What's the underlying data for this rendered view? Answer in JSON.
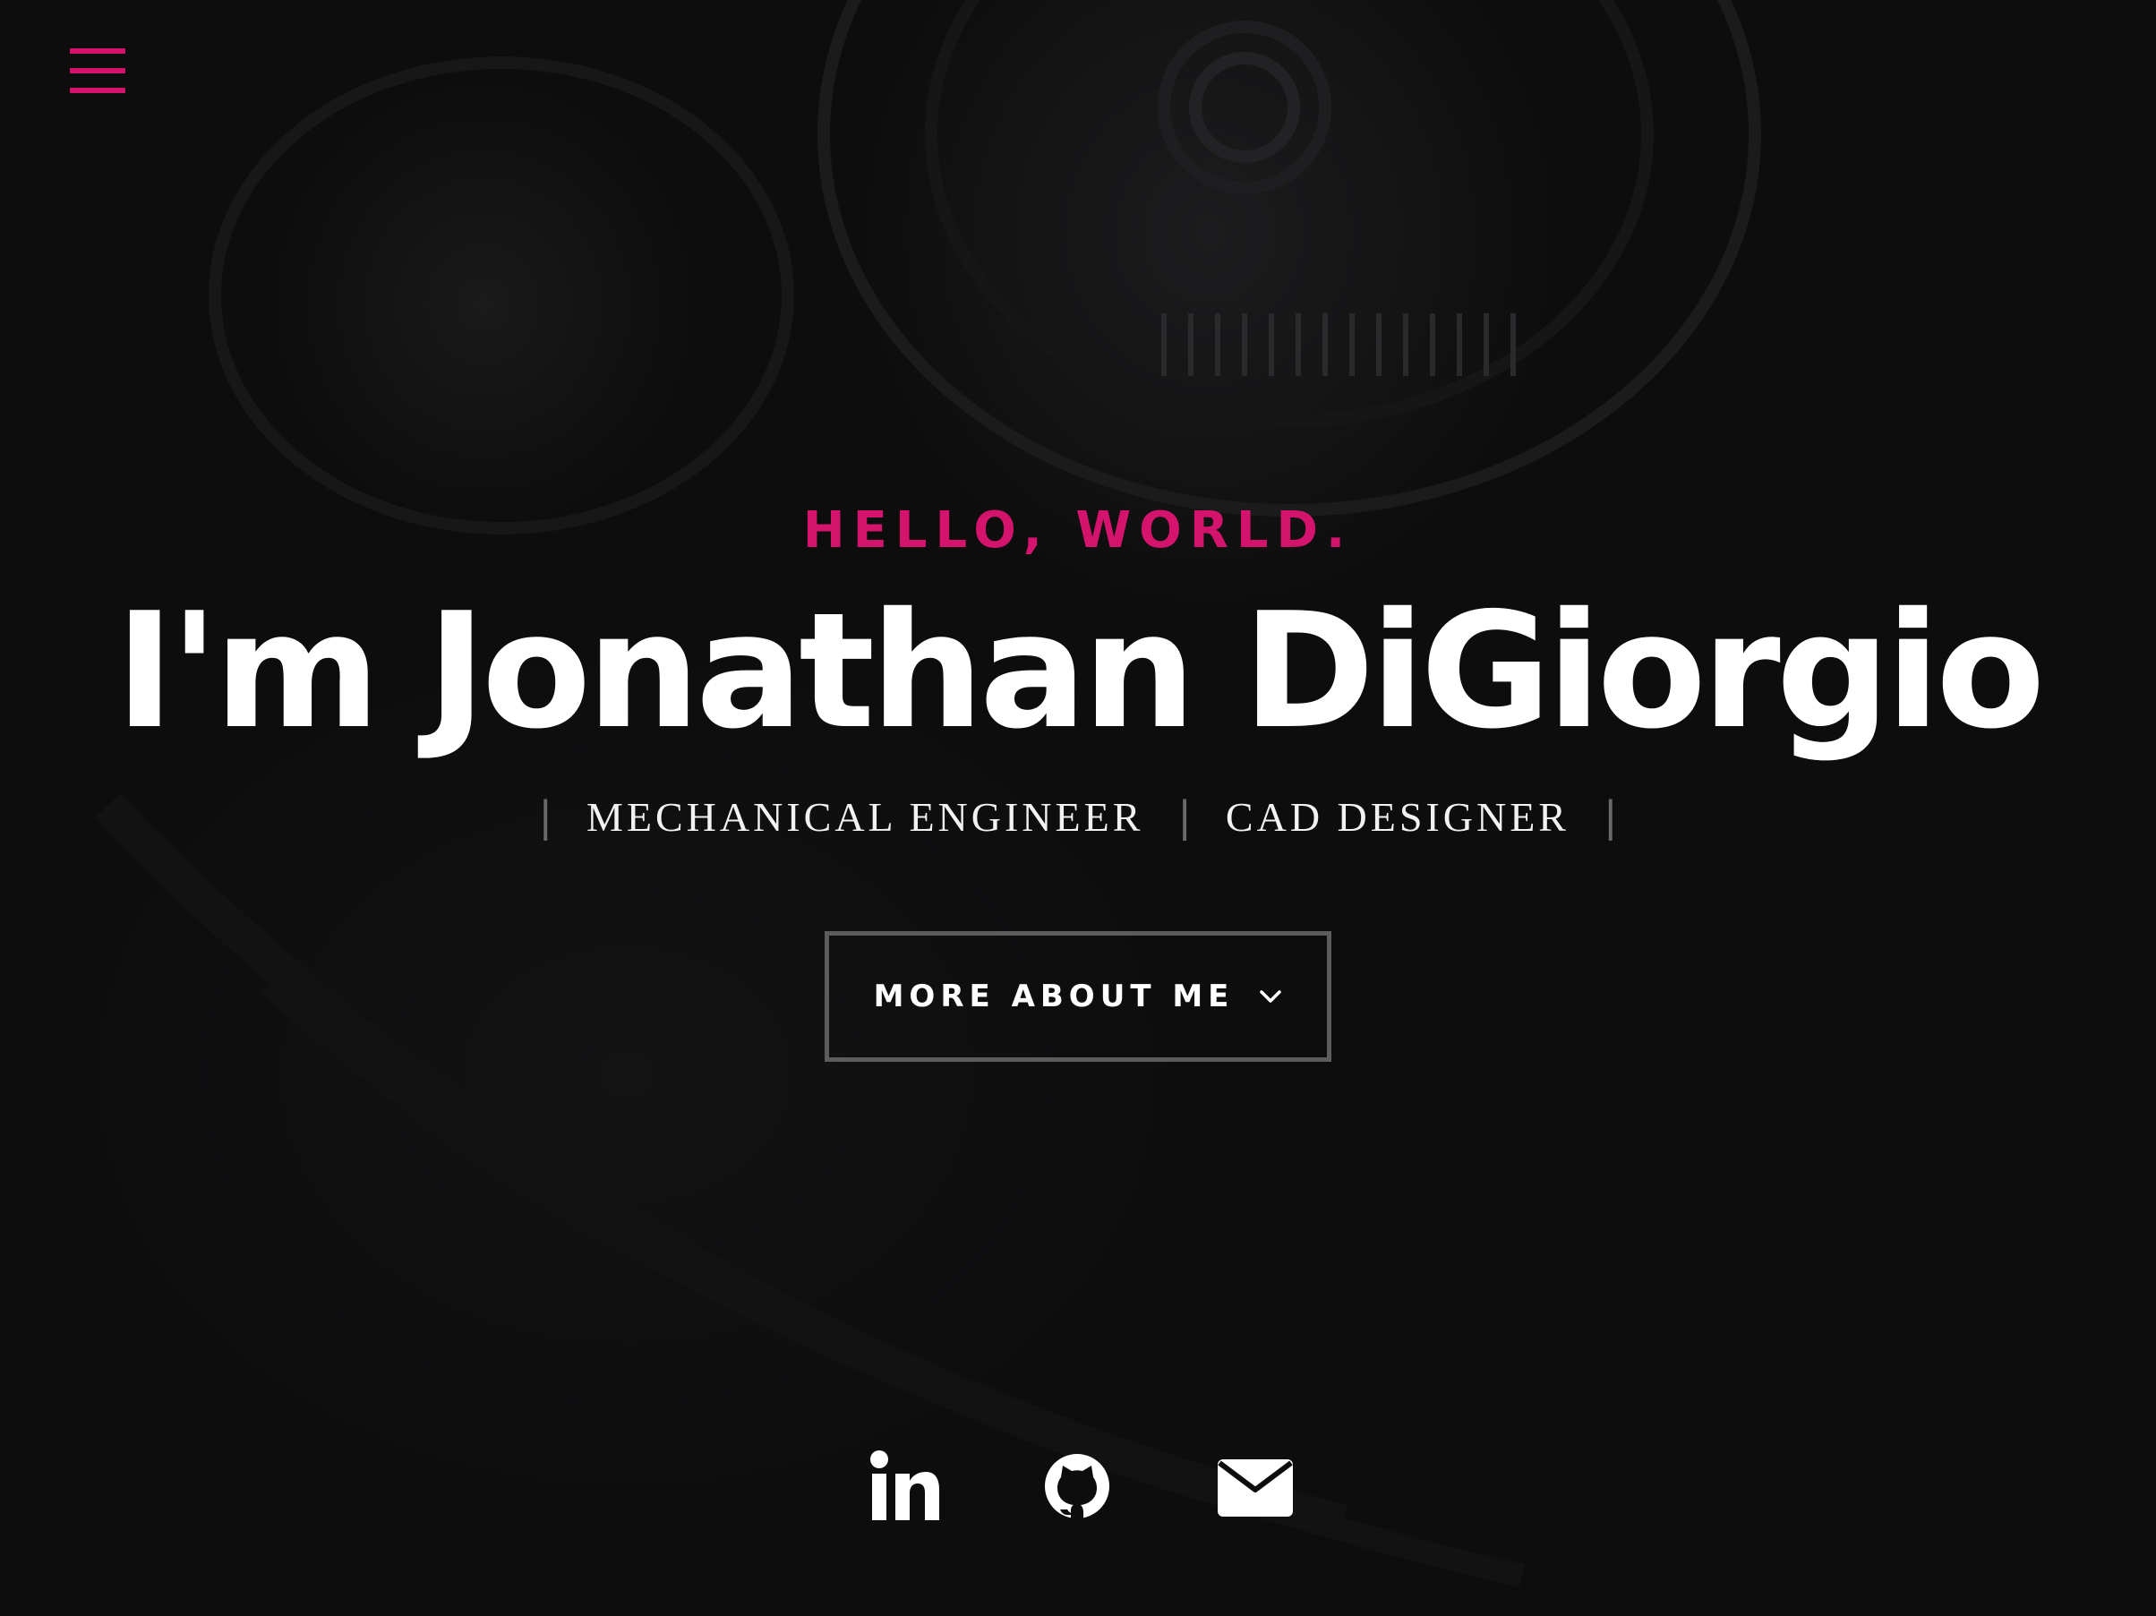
{
  "menu": {
    "icon": "hamburger-menu-icon",
    "color": "#d4136d"
  },
  "hero": {
    "greeting": "HELLO, WORLD.",
    "name": "I'm Jonathan DiGiorgio",
    "roles": [
      "MECHANICAL ENGINEER",
      "CAD DESIGNER"
    ],
    "role_separator": "|",
    "cta_label": "MORE ABOUT ME",
    "cta_icon": "chevron-down-icon",
    "accent_color": "#d4136d"
  },
  "socials": [
    {
      "name": "LinkedIn",
      "icon": "linkedin-icon"
    },
    {
      "name": "GitHub",
      "icon": "github-icon"
    },
    {
      "name": "Email",
      "icon": "envelope-icon"
    }
  ]
}
